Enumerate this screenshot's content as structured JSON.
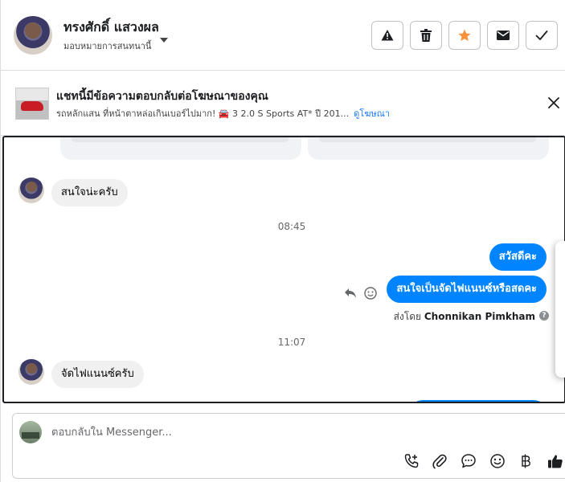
{
  "header": {
    "contact_name": "ทรงศักดิ์ แสวงผล",
    "assign_label": "มอบหมายการสนทนานี้",
    "buttons": [
      "alert-icon",
      "trash-icon",
      "star-icon",
      "envelope-icon",
      "check-icon"
    ],
    "star_color": "#f7923a"
  },
  "ad": {
    "title": "แชทนี้มีข้อความตอบกลับต่อโฆษณาของคุณ",
    "description": "รถหลักแสน ที่หน้าตาหล่อเกินเบอร์ไปมาก! 🚘 3 2.0 S Sports AT* ปี 201...",
    "link": "ดูโฆษณา",
    "link_color": "#1877f2"
  },
  "chat": {
    "messages": [
      {
        "side": "in",
        "text": "สนใจน่ะครับ"
      },
      {
        "type": "time",
        "text": "08:45"
      },
      {
        "side": "out",
        "text": "สวัสดีคะ"
      },
      {
        "side": "out",
        "text": "สนใจเป็นจัดไฟแนนซ์หรือสดคะ"
      },
      {
        "type": "sent_by",
        "prefix": "ส่งโดย",
        "name": "Chonnikan Pimkham"
      },
      {
        "type": "time",
        "text": "11:07"
      },
      {
        "side": "in",
        "text": "จัดไฟแนนซ์ครับ"
      }
    ],
    "outgoing_color": "#0084ff",
    "incoming_color": "#f0f0f0"
  },
  "composer": {
    "placeholder": "ตอบกลับใน Messenger...",
    "tools": [
      "phone-plus-icon",
      "paperclip-icon",
      "chat-bubble-icon",
      "emoji-icon",
      "baht-icon",
      "thumbs-up-icon"
    ]
  }
}
